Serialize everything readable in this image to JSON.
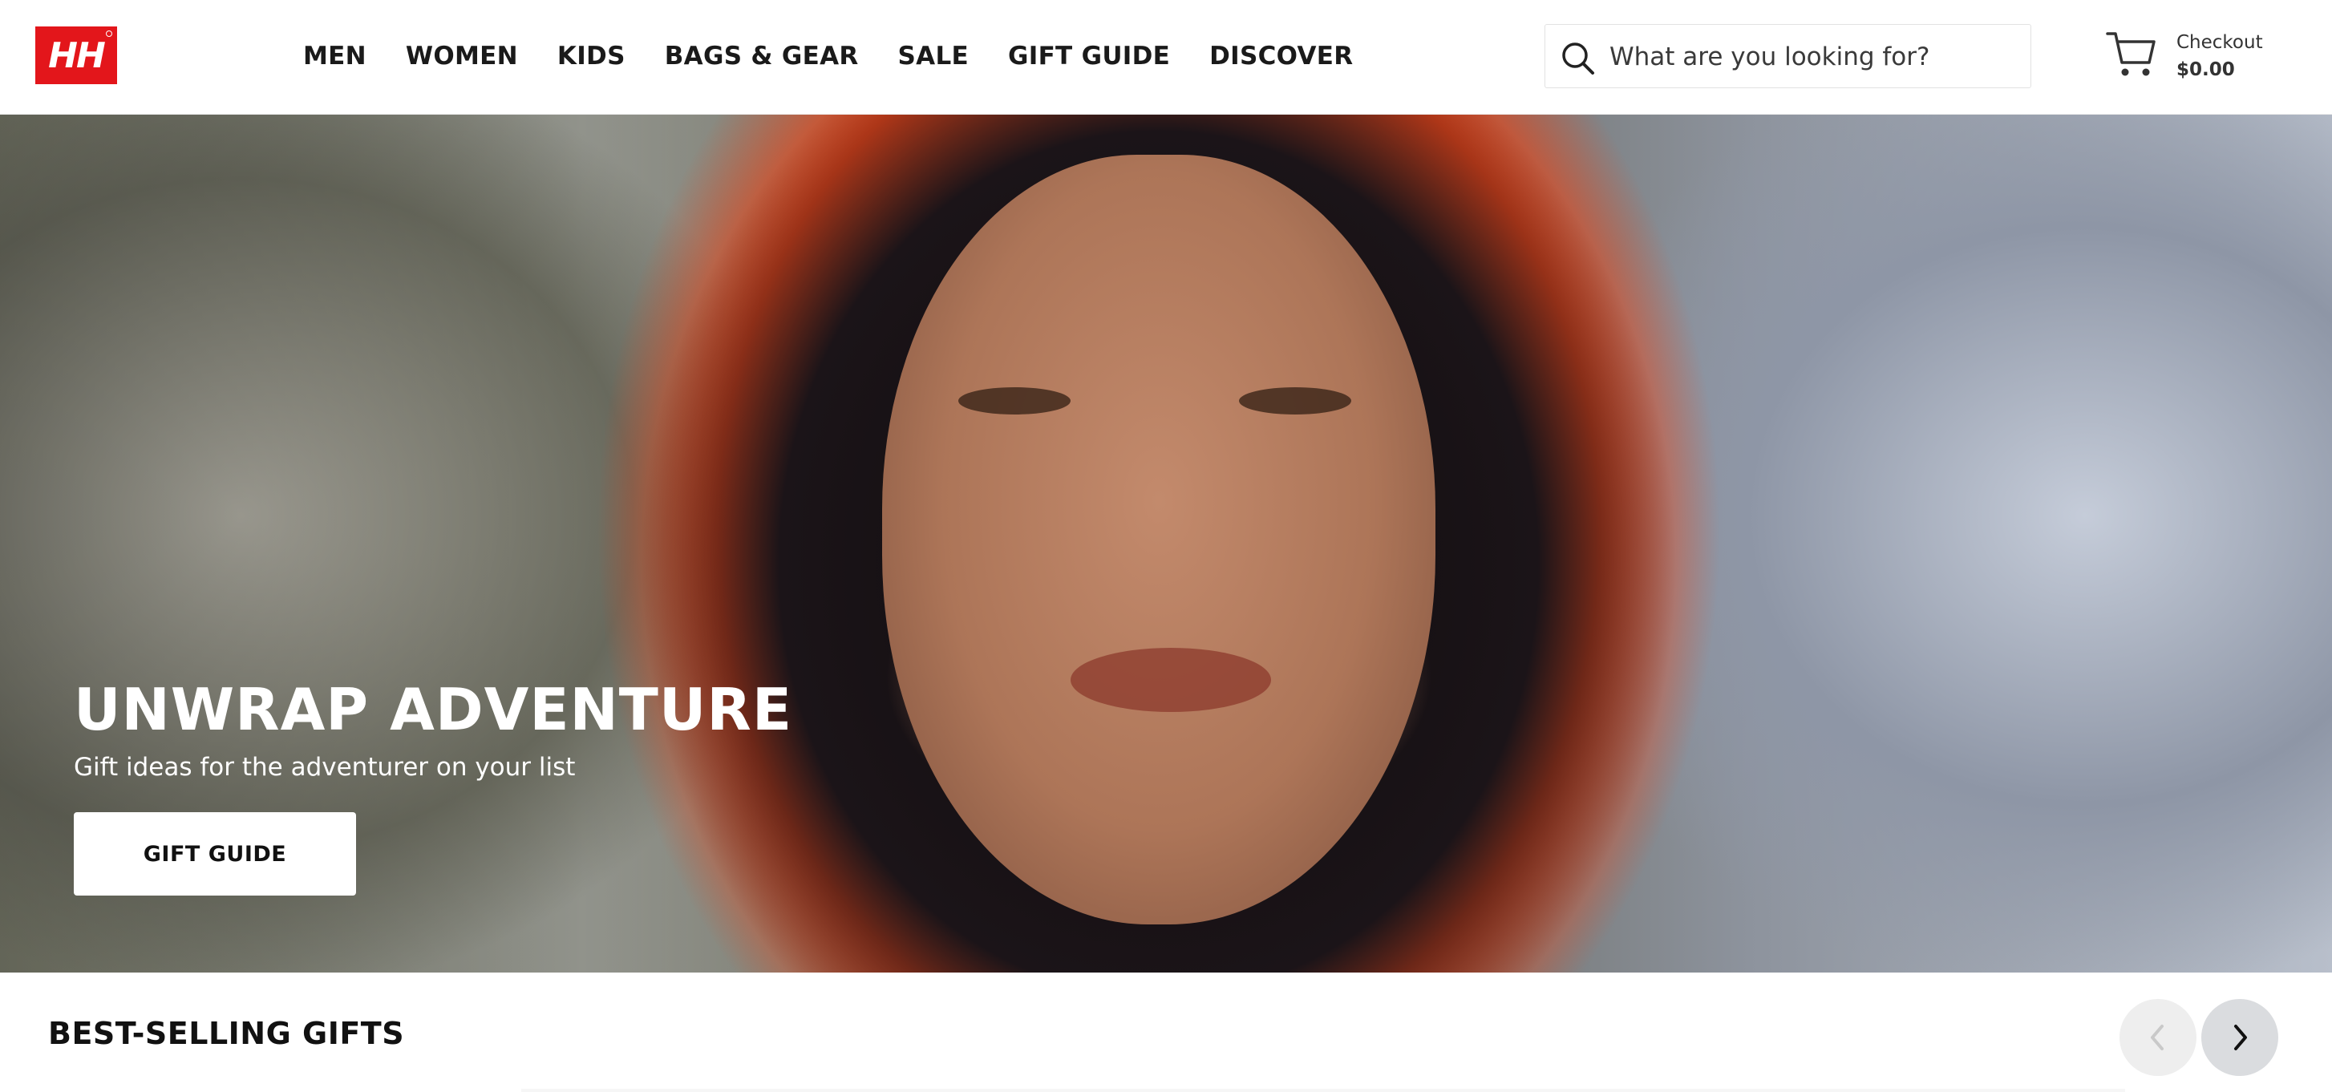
{
  "brand": {
    "logo_text": "HH",
    "color": "#e3161b"
  },
  "nav": {
    "items": [
      "MEN",
      "WOMEN",
      "KIDS",
      "BAGS & GEAR",
      "SALE",
      "GIFT GUIDE",
      "DISCOVER"
    ]
  },
  "search": {
    "placeholder": "What are you looking for?",
    "icon": "search-icon"
  },
  "cart": {
    "icon": "cart-icon",
    "label": "Checkout",
    "total": "$0.00"
  },
  "hero": {
    "title": "UNWRAP ADVENTURE",
    "subtitle": "Gift ideas for the adventurer on your list",
    "cta_label": "GIFT GUIDE"
  },
  "carousel": {
    "title": "BEST-SELLING GIFTS",
    "prev_icon": "chevron-left-icon",
    "next_icon": "chevron-right-icon"
  }
}
